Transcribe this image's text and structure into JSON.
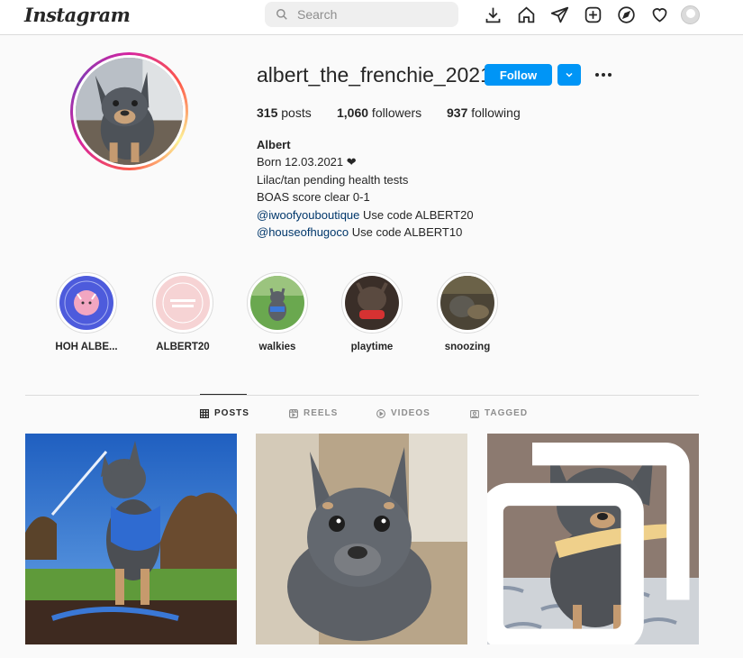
{
  "nav": {
    "logo": "Instagram",
    "search_placeholder": "Search",
    "icons": [
      "download-icon",
      "home-icon",
      "direct-icon",
      "new-post-icon",
      "explore-icon",
      "activity-icon",
      "profile-avatar"
    ]
  },
  "profile": {
    "username": "albert_the_frenchie_2021",
    "follow_label": "Follow",
    "stats": {
      "posts_count": "315",
      "posts_label": " posts",
      "followers_count": "1,060",
      "followers_label": " followers",
      "following_count": "937",
      "following_label": " following"
    },
    "bio": {
      "name": "Albert",
      "line1": "Born 12.03.2021 ❤",
      "line2": "Lilac/tan pending health tests",
      "line3": "BOAS score clear 0-1",
      "mention1": "@iwoofyouboutique",
      "mention1_text": " Use code ALBERT20",
      "mention2": "@houseofhugoco",
      "mention2_text": " Use code ALBERT10"
    }
  },
  "highlights": [
    {
      "label": "HOH ALBE..."
    },
    {
      "label": "ALBERT20"
    },
    {
      "label": "walkies"
    },
    {
      "label": "playtime"
    },
    {
      "label": "snoozing"
    }
  ],
  "tabs": {
    "posts": "POSTS",
    "reels": "REELS",
    "videos": "VIDEOS",
    "tagged": "TAGGED"
  },
  "colors": {
    "accent": "#0095f6",
    "link": "#00376b",
    "muted": "#8e8e8e",
    "border": "#dbdbdb"
  }
}
